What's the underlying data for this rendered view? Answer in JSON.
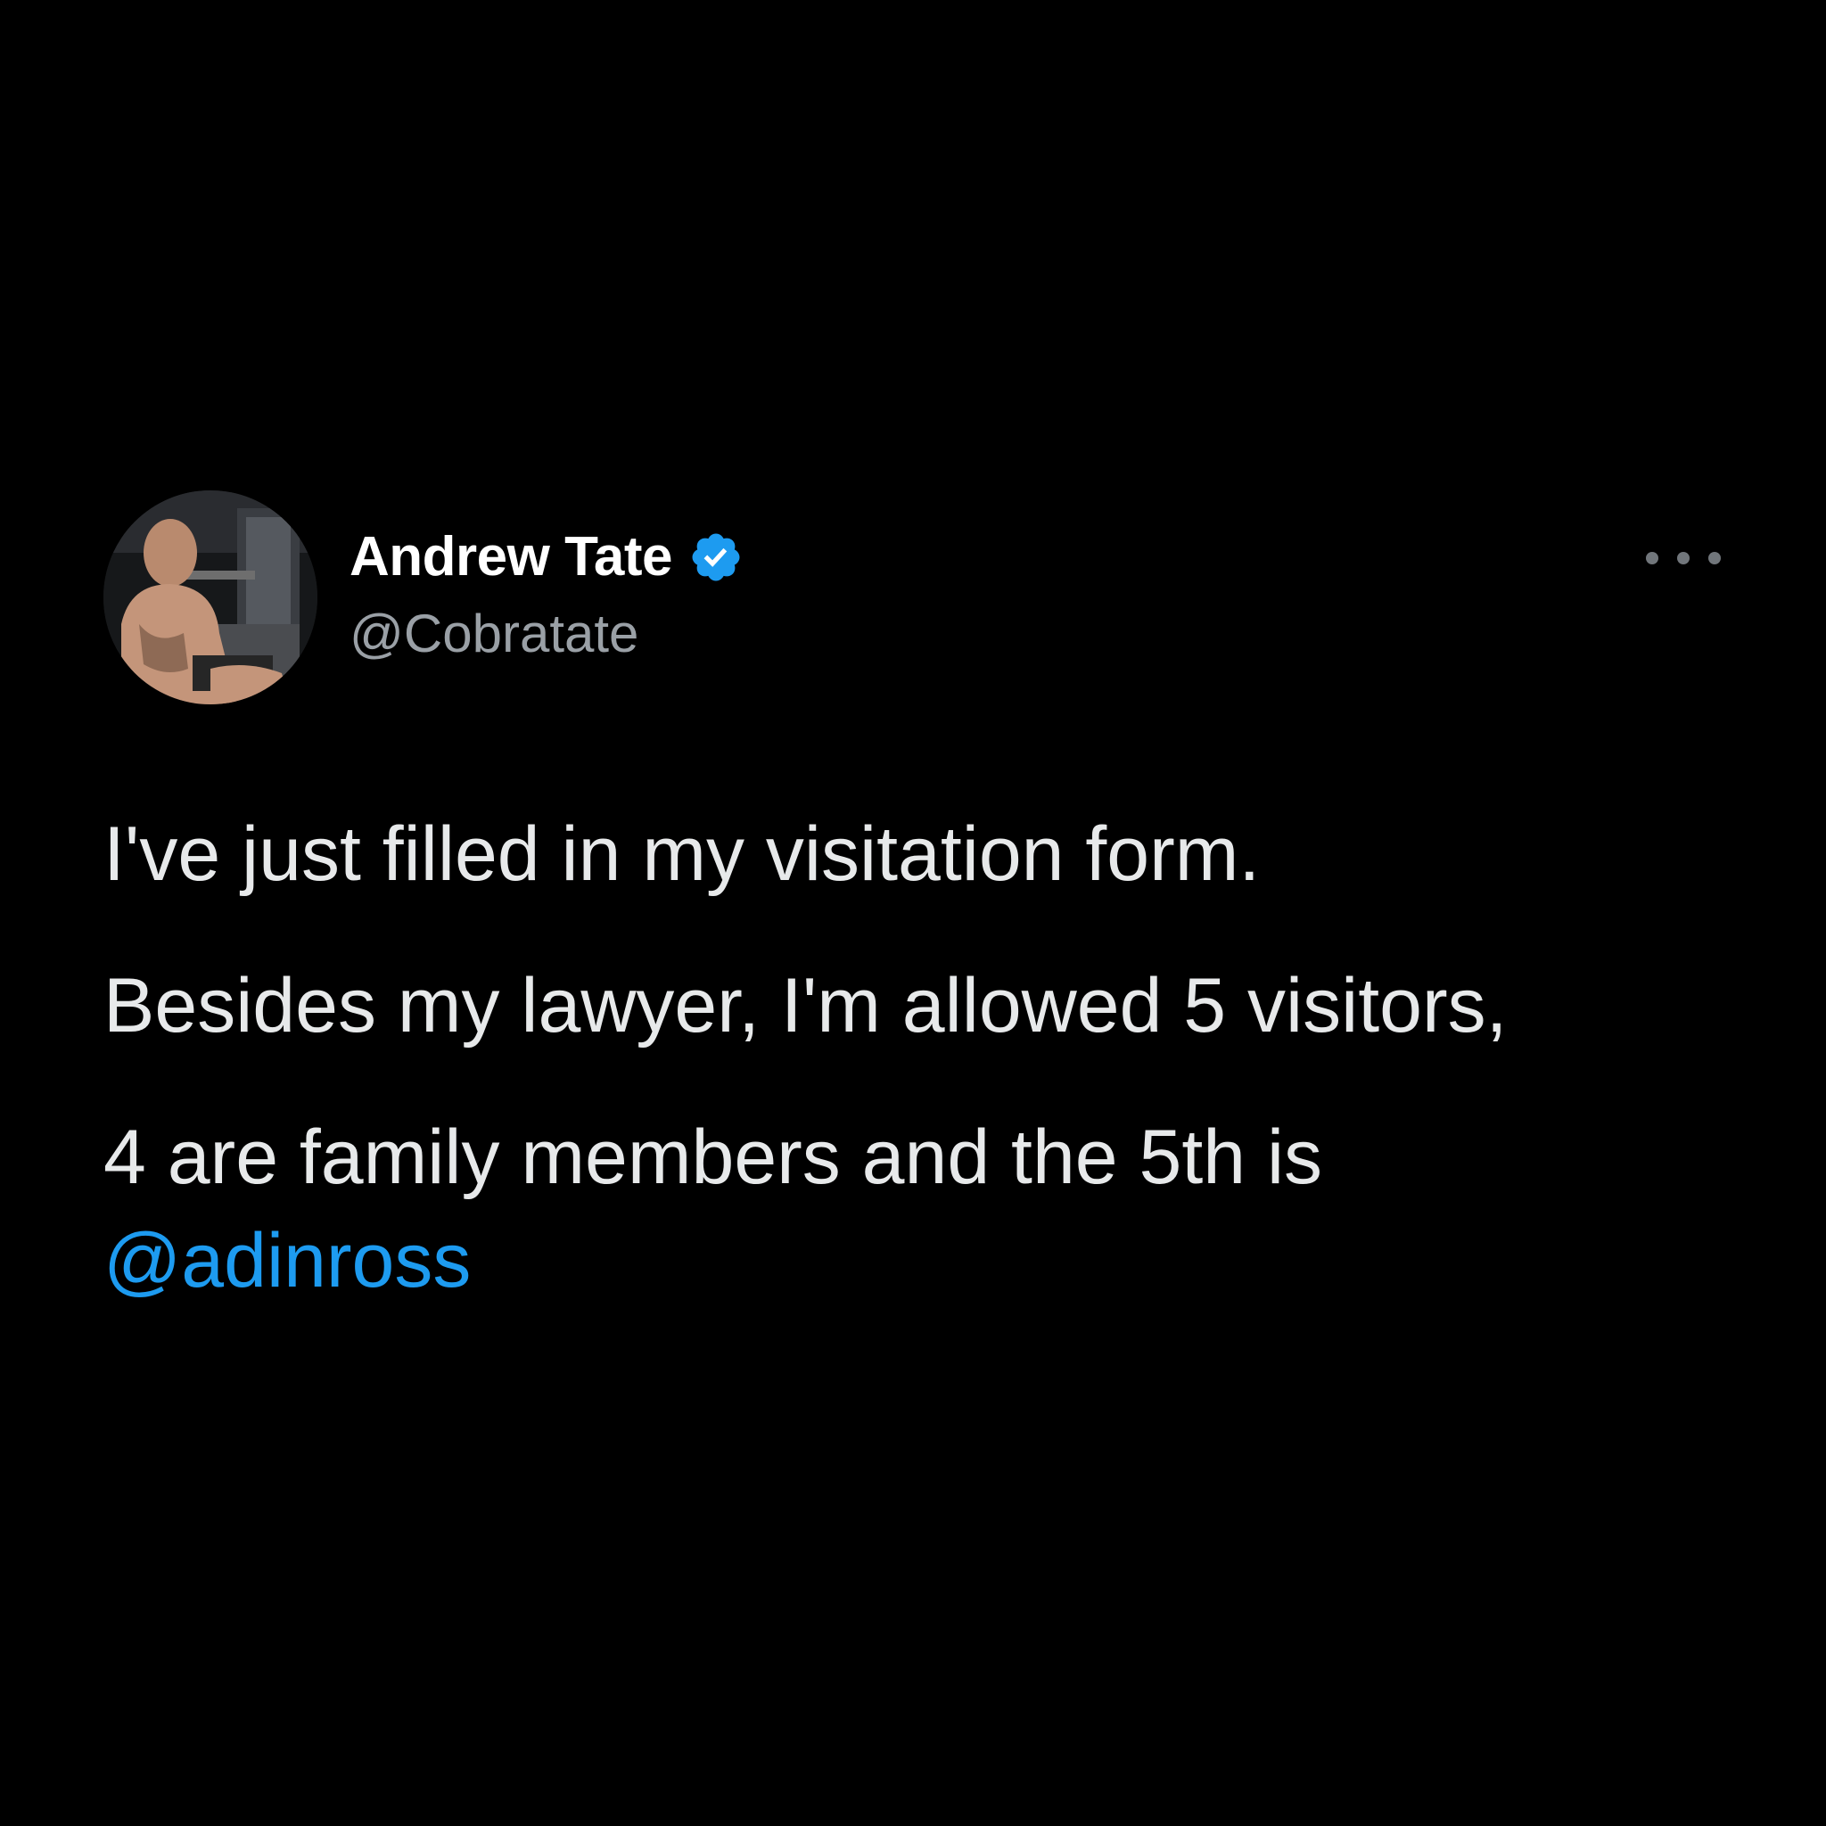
{
  "tweet": {
    "author": {
      "display_name": "Andrew Tate",
      "handle": "@Cobratate",
      "verified": true,
      "avatar_icon": "profile-photo"
    },
    "more_icon": "more-horizontal-icon",
    "lines": [
      "I've just filled in my visitation form.",
      "Besides my lawyer, I'm allowed 5 visitors,",
      "4 are family members and the 5th is"
    ],
    "mention": "@adinross"
  },
  "colors": {
    "background": "#000000",
    "text": "#e7e9ea",
    "secondary_text": "#9aa0a6",
    "accent": "#1d9bf0"
  }
}
